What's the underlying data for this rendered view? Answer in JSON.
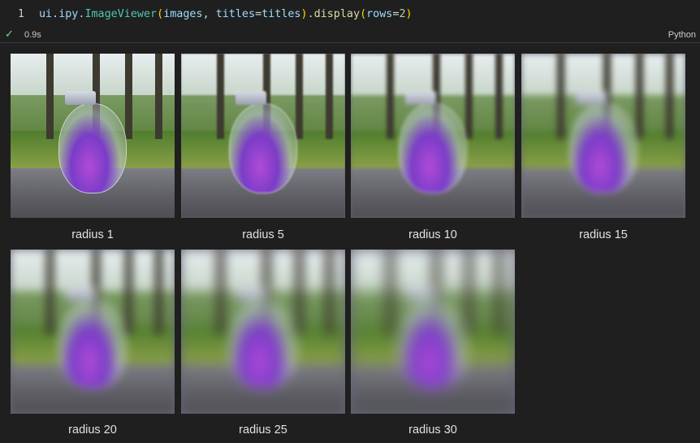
{
  "cell": {
    "line_number": "1",
    "code": {
      "receiver": "ui",
      "module": "ipy",
      "class_name": "ImageViewer",
      "arg_images": "images",
      "kw_titles": "titles",
      "arg_titles": "titles",
      "method": "display",
      "kw_rows": "rows",
      "rows_value": "2"
    },
    "status_icon": "check-icon",
    "exec_time": "0.9s",
    "language": "Python"
  },
  "output": {
    "rows": 2,
    "captions": [
      "radius 1",
      "radius 5",
      "radius 10",
      "radius 15",
      "radius 20",
      "radius 25",
      "radius 30"
    ]
  }
}
